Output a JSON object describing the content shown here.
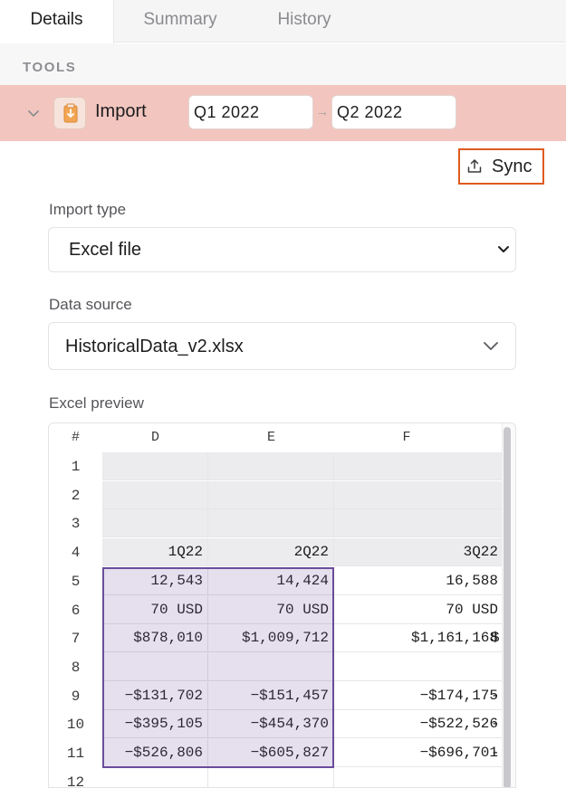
{
  "tabs": [
    {
      "label": "Details",
      "active": true
    },
    {
      "label": "Summary",
      "active": false
    },
    {
      "label": "History",
      "active": false
    }
  ],
  "tools": {
    "section_label": "TOOLS",
    "import": {
      "label": "Import",
      "from": "Q1 2022",
      "to": "Q2 2022",
      "row_color": "#f2c6bf"
    }
  },
  "sync": {
    "label": "Sync",
    "highlight_color": "#e05a1f"
  },
  "import_type": {
    "label": "Import type",
    "value": "Excel file"
  },
  "data_source": {
    "label": "Data source",
    "value": "HistoricalData_v2.xlsx"
  },
  "preview": {
    "label": "Excel preview",
    "columns": [
      "#",
      "D",
      "E",
      "F"
    ],
    "rows": [
      {
        "n": "1",
        "cells": [
          "",
          "",
          "",
          ""
        ]
      },
      {
        "n": "2",
        "cells": [
          "",
          "",
          "",
          ""
        ]
      },
      {
        "n": "3",
        "cells": [
          "",
          "",
          "",
          ""
        ]
      },
      {
        "n": "4",
        "cells": [
          "1Q22",
          "2Q22",
          "3Q22",
          ""
        ]
      },
      {
        "n": "5",
        "cells": [
          "12,543",
          "14,424",
          "16,588",
          ""
        ]
      },
      {
        "n": "6",
        "cells": [
          "70 USD",
          "70 USD",
          "70 USD",
          ""
        ]
      },
      {
        "n": "7",
        "cells": [
          "$878,010",
          "$1,009,712",
          "$1,161,168",
          "$"
        ]
      },
      {
        "n": "8",
        "cells": [
          "",
          "",
          "",
          ""
        ]
      },
      {
        "n": "9",
        "cells": [
          "−$131,702",
          "−$151,457",
          "−$174,175",
          "-"
        ]
      },
      {
        "n": "10",
        "cells": [
          "−$395,105",
          "−$454,370",
          "−$522,526",
          "-"
        ]
      },
      {
        "n": "11",
        "cells": [
          "−$526,806",
          "−$605,827",
          "−$696,701",
          "-"
        ]
      },
      {
        "n": "12",
        "cells": [
          "",
          "",
          "",
          ""
        ]
      }
    ],
    "selection_color": "#6a4c9c"
  }
}
